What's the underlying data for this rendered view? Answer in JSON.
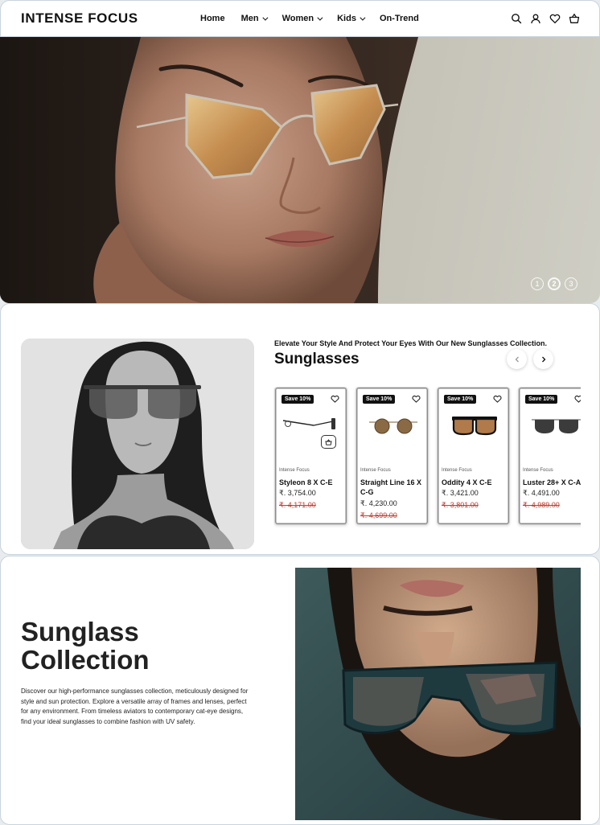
{
  "header": {
    "logo": "INTENSE FOCUS",
    "nav": [
      {
        "label": "Home",
        "has_dropdown": false
      },
      {
        "label": "Men",
        "has_dropdown": true
      },
      {
        "label": "Women",
        "has_dropdown": true
      },
      {
        "label": "Kids",
        "has_dropdown": true
      },
      {
        "label": "On-Trend",
        "has_dropdown": false
      }
    ],
    "icons": [
      "search-icon",
      "account-icon",
      "wishlist-icon",
      "cart-icon"
    ]
  },
  "hero": {
    "slides": [
      "1",
      "2",
      "3"
    ],
    "active_slide": "2"
  },
  "sunglasses": {
    "kicker": "Elevate Your Style And Protect Your Eyes With Our New Sunglasses Collection.",
    "title": "Sunglasses",
    "products": [
      {
        "badge": "Save 10%",
        "brand": "Intense Focus",
        "name": "Styleon 8 X C-E",
        "price": "₹. 3,754.00",
        "compare_price": "₹. 4,171.00"
      },
      {
        "badge": "Save 10%",
        "brand": "Intense Focus",
        "name": "Straight Line 16 X C-G",
        "price": "₹. 4,230.00",
        "compare_price": "₹. 4,699.00"
      },
      {
        "badge": "Save 10%",
        "brand": "Intense Focus",
        "name": "Oddity 4 X C-E",
        "price": "₹. 3,421.00",
        "compare_price": "₹. 3,801.00"
      },
      {
        "badge": "Save 10%",
        "brand": "Intense Focus",
        "name": "Luster 28+ X C-A",
        "price": "₹. 4,491.00",
        "compare_price": "₹. 4,989.00"
      }
    ]
  },
  "collection": {
    "title": "Sunglass Collection",
    "description": "Discover our high-performance sunglasses collection, meticulously designed for style and sun protection. Explore a versatile array of frames and lenses, perfect for any environment. From timeless aviators to contemporary cat-eye designs, find your ideal sunglasses to combine fashion with UV safety."
  },
  "colors": {
    "accent": "#111111",
    "sale_red": "#c0392b",
    "border": "#c9d3de"
  }
}
